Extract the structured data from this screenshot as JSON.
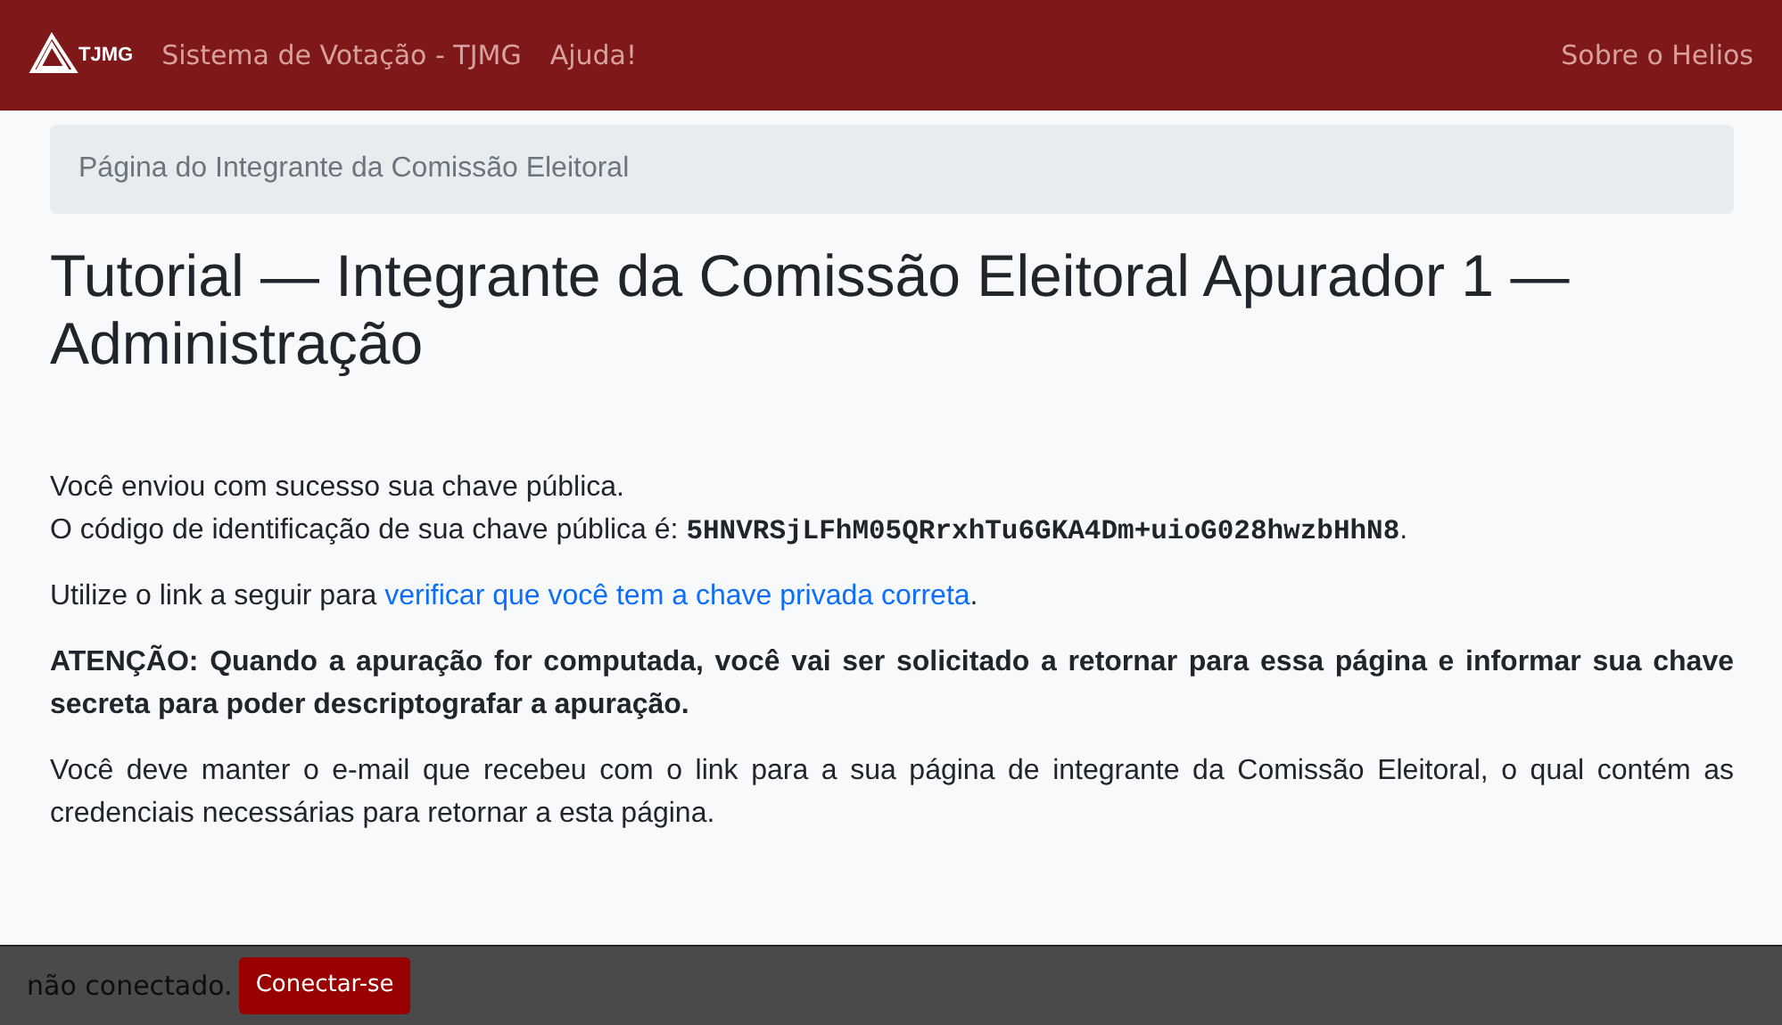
{
  "navbar": {
    "logo_text": "TJMG",
    "links": [
      "Sistema de Votação - TJMG",
      "Ajuda!"
    ],
    "right_link": "Sobre o Helios"
  },
  "breadcrumb": "Página do Integrante da Comissão Eleitoral",
  "title": "Tutorial — Integrante da Comissão Eleitoral Apurador 1 — Administração",
  "key_paragraph": {
    "line_1": "Você enviou com sucesso sua chave pública.",
    "line_2_before": "O código de identificação de sua chave pública é: ",
    "code": "5HNVRSjLFhM05QRrxhTu6GKA4Dm+uioG028hwzbHhN8",
    "line_2_after": "."
  },
  "link_paragraph": {
    "before": "Utilize o link a seguir para ",
    "link": "verificar que você tem a chave privada correta",
    "after": "."
  },
  "warning": "ATENÇÃO: Quando a apuração for computada, você vai ser solicitado a retornar para essa página e informar sua chave secreta para poder descriptografar a apuração.",
  "note": "Você deve manter o e-mail que recebeu com o link para a sua página de integrante da Comissão Eleitoral, o qual contém as credenciais necessárias para retornar a esta página.",
  "footer": {
    "status": "não conectado.",
    "button": "Conectar-se"
  }
}
